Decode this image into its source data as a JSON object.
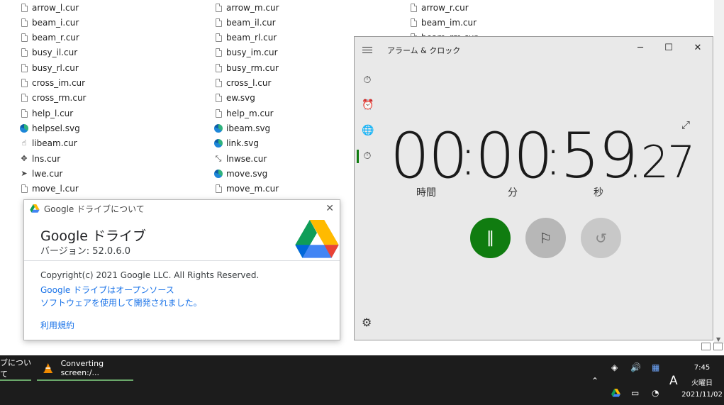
{
  "explorer": {
    "columns": [
      [
        {
          "name": "arrow_l.cur",
          "icon": "doc"
        },
        {
          "name": "beam_i.cur",
          "icon": "doc"
        },
        {
          "name": "beam_r.cur",
          "icon": "doc"
        },
        {
          "name": "busy_il.cur",
          "icon": "doc"
        },
        {
          "name": "busy_rl.cur",
          "icon": "doc"
        },
        {
          "name": "cross_im.cur",
          "icon": "doc"
        },
        {
          "name": "cross_rm.cur",
          "icon": "doc"
        },
        {
          "name": "help_l.cur",
          "icon": "doc"
        },
        {
          "name": "helpsel.svg",
          "icon": "edge"
        },
        {
          "name": "libeam.cur",
          "icon": "hand"
        },
        {
          "name": "lns.cur",
          "icon": "move"
        },
        {
          "name": "lwe.cur",
          "icon": "pointer"
        },
        {
          "name": "move_l.cur",
          "icon": "doc"
        }
      ],
      [
        {
          "name": "arrow_m.cur",
          "icon": "doc"
        },
        {
          "name": "beam_il.cur",
          "icon": "doc"
        },
        {
          "name": "beam_rl.cur",
          "icon": "doc"
        },
        {
          "name": "busy_im.cur",
          "icon": "doc"
        },
        {
          "name": "busy_rm.cur",
          "icon": "doc"
        },
        {
          "name": "cross_l.cur",
          "icon": "doc"
        },
        {
          "name": "ew.svg",
          "icon": "doc"
        },
        {
          "name": "help_m.cur",
          "icon": "doc"
        },
        {
          "name": "ibeam.svg",
          "icon": "edge"
        },
        {
          "name": "link.svg",
          "icon": "edge"
        },
        {
          "name": "lnwse.cur",
          "icon": "diag"
        },
        {
          "name": "move.svg",
          "icon": "edge"
        },
        {
          "name": "move_m.cur",
          "icon": "doc"
        }
      ],
      [
        {
          "name": "arrow_r.cur",
          "icon": "doc"
        },
        {
          "name": "beam_im.cur",
          "icon": "doc"
        },
        {
          "name": "beam_rm.cur",
          "icon": "doc"
        }
      ]
    ]
  },
  "drive_dialog": {
    "title": "Google ドライブについて",
    "app_name": "Google ドライブ",
    "version": "バージョン: 52.0.6.0",
    "copyright": "Copyright(c) 2021 Google LLC. All Rights Reserved.",
    "oss_line1": "Google ドライブはオープンソース",
    "oss_line2": "ソフトウェアを使用して開発されました。",
    "terms": "利用規約",
    "close_glyph": "✕"
  },
  "clock": {
    "title": "アラーム & クロック",
    "hours": "00",
    "minutes": "00",
    "seconds": "59",
    "hundredths": ".27",
    "sep": ":",
    "unit_hours": "時間",
    "unit_minutes": "分",
    "unit_seconds": "秒",
    "accent": "#107c10"
  },
  "taskbar": {
    "item1": "ブについて",
    "item2": "Converting screen:/...",
    "time": "7:45",
    "day": "火曜日",
    "date": "2021/11/02",
    "ime": "A"
  }
}
